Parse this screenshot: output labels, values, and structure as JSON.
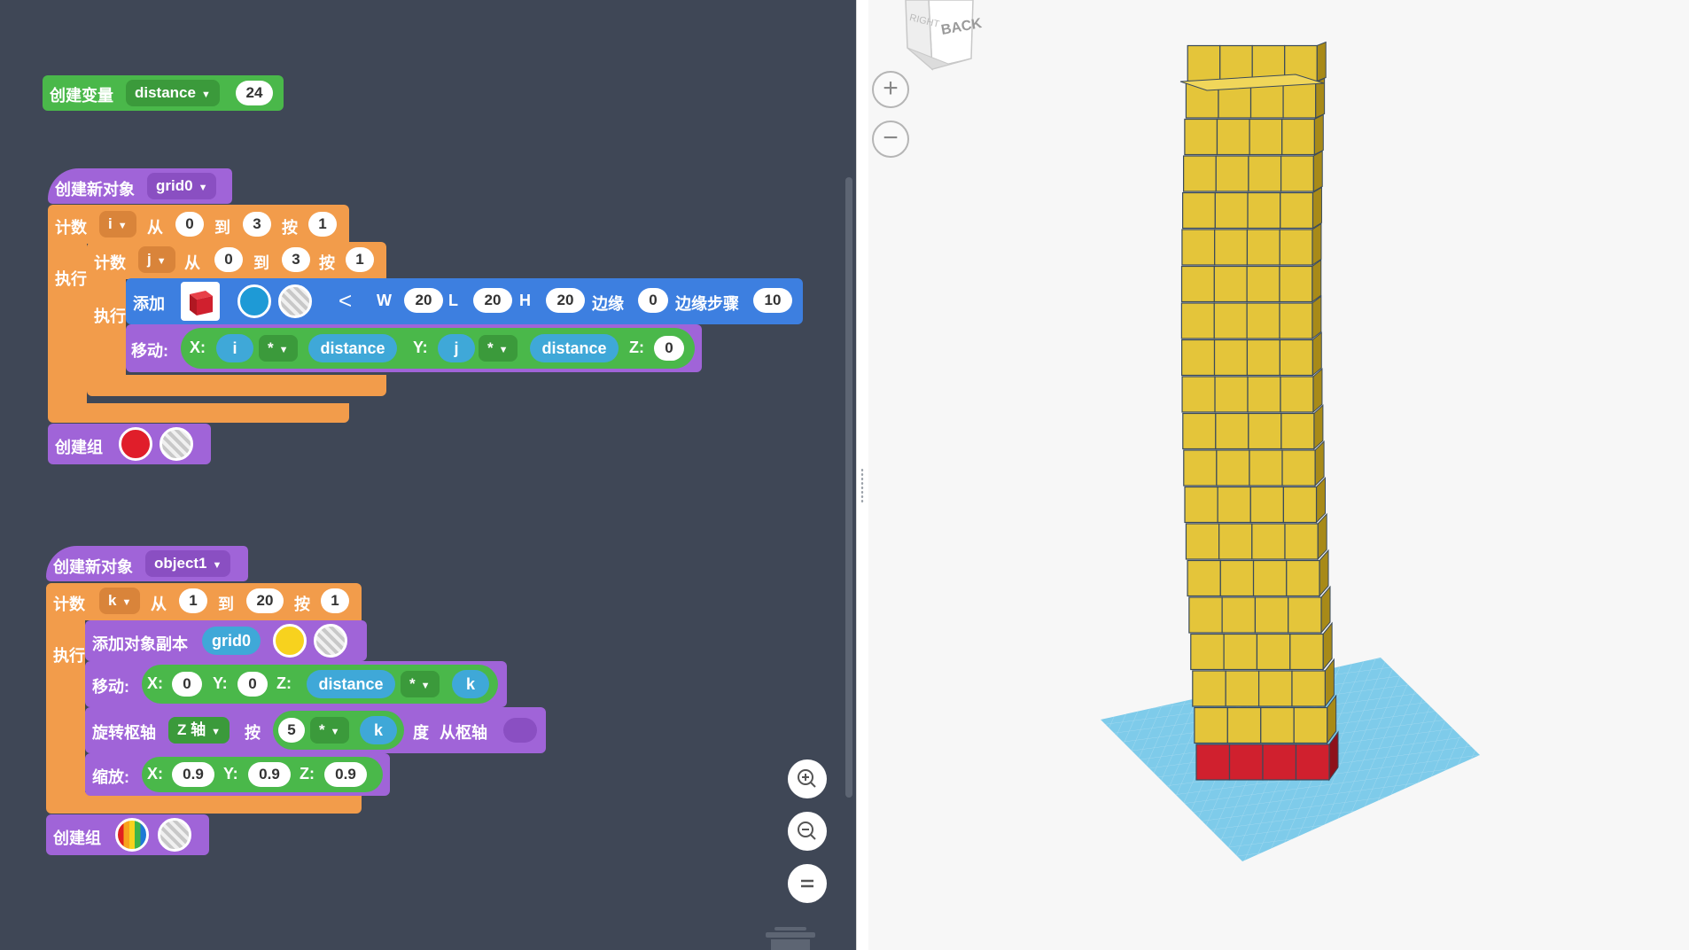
{
  "blocks": {
    "create_variable": {
      "label": "创建变量",
      "var": "distance",
      "value": "24"
    },
    "obj1": {
      "label": "创建新对象",
      "name": "grid0"
    },
    "loop_i": {
      "count": "计数",
      "var": "i",
      "from": "从",
      "start": "0",
      "to": "到",
      "end": "3",
      "by": "按",
      "step": "1",
      "exec": "执行"
    },
    "loop_j": {
      "count": "计数",
      "var": "j",
      "from": "从",
      "start": "0",
      "to": "到",
      "end": "3",
      "by": "按",
      "step": "1",
      "exec": "执行"
    },
    "add": {
      "label": "添加",
      "w_label": "W",
      "w": "20",
      "l_label": "L",
      "l": "20",
      "h_label": "H",
      "h": "20",
      "edge_label": "边缘",
      "edge": "0",
      "steps_label": "边缘步骤",
      "steps": "10"
    },
    "move1": {
      "label": "移动:",
      "x_label": "X:",
      "x_var": "i",
      "op": "*",
      "x_mult": "distance",
      "y_label": "Y:",
      "y_var": "j",
      "y_op": "*",
      "y_mult": "distance",
      "z_label": "Z:",
      "z": "0"
    },
    "group1": {
      "label": "创建组"
    },
    "obj2": {
      "label": "创建新对象",
      "name": "object1"
    },
    "loop_k": {
      "count": "计数",
      "var": "k",
      "from": "从",
      "start": "1",
      "to": "到",
      "end": "20",
      "by": "按",
      "step": "1",
      "exec": "执行"
    },
    "copy": {
      "label": "添加对象副本",
      "obj": "grid0"
    },
    "move2": {
      "label": "移动:",
      "x_label": "X:",
      "x": "0",
      "y_label": "Y:",
      "y": "0",
      "z_label": "Z:",
      "z_var": "distance",
      "op": "*",
      "z_mult": "k"
    },
    "rotate": {
      "label": "旋转枢轴",
      "axis": "Z 轴",
      "by": "按",
      "val": "5",
      "op": "*",
      "mult": "k",
      "deg": "度",
      "pivot": "从枢轴"
    },
    "scale": {
      "label": "缩放:",
      "x_label": "X:",
      "x": "0.9",
      "y_label": "Y:",
      "y": "0.9",
      "z_label": "Z:",
      "z": "0.9"
    },
    "group2": {
      "label": "创建组"
    }
  },
  "viewcube": {
    "right": "RIGHT",
    "back": "BACK"
  },
  "view_controls": {
    "zoom_in": "+",
    "zoom_out": "−"
  },
  "colors": {
    "workspace_bg": "#3f4756",
    "loop": "#f29c4b",
    "object": "#a064d8",
    "math": "#4ab84a",
    "shape": "#3d7fe0",
    "tower_top": "#e4c53a",
    "tower_base": "#d0202e",
    "grid": "#7ecbea"
  }
}
